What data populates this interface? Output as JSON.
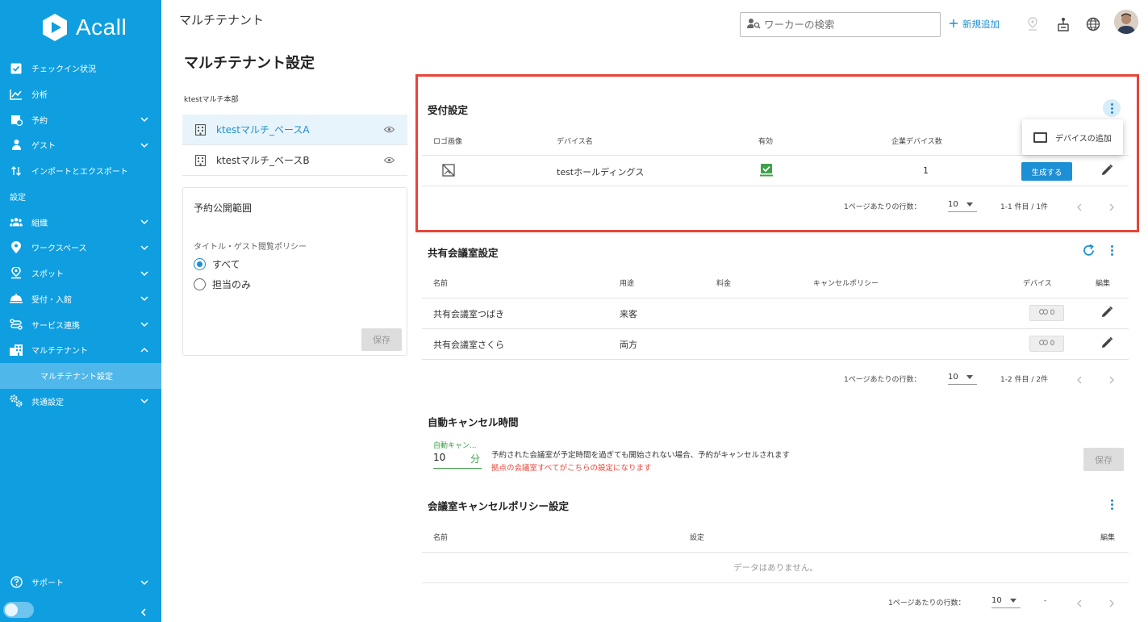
{
  "app": {
    "logo_text": "Acall",
    "page_header": "マルチテナント",
    "search_placeholder": "ワーカーの検索",
    "add_new_label": "新規追加"
  },
  "sidebar": {
    "items": [
      {
        "label": "チェックイン状況",
        "icon": "checkbox-icon"
      },
      {
        "label": "分析",
        "icon": "chart-icon"
      },
      {
        "label": "予約",
        "icon": "calendar-icon",
        "expandable": true
      },
      {
        "label": "ゲスト",
        "icon": "guest-icon",
        "expandable": true
      },
      {
        "label": "インポートとエクスポート",
        "icon": "import-export-icon"
      }
    ],
    "section_label": "設定",
    "settings_items": [
      {
        "label": "組織",
        "icon": "people-icon",
        "expandable": true
      },
      {
        "label": "ワークスペース",
        "icon": "location-icon",
        "expandable": true
      },
      {
        "label": "スポット",
        "icon": "spot-icon",
        "expandable": true
      },
      {
        "label": "受付・入館",
        "icon": "reception-icon",
        "expandable": true
      },
      {
        "label": "サービス連携",
        "icon": "integration-icon",
        "expandable": true
      },
      {
        "label": "マルチテナント",
        "icon": "building-icon",
        "expanded": true
      }
    ],
    "sub_item": "マルチテナント設定",
    "common_settings": "共通設定",
    "support": "サポート"
  },
  "left": {
    "title": "マルチテナント設定",
    "org_label": "ktestマルチ本部",
    "tenants": [
      {
        "name": "ktestマルチ_ベースA",
        "active": true
      },
      {
        "name": "ktestマルチ_ベースB",
        "active": false
      }
    ],
    "card_title": "予約公開範囲",
    "policy_label": "タイトル・ゲスト閲覧ポリシー",
    "options": [
      "すべて",
      "担当のみ"
    ],
    "selected_option": "すべて",
    "save_label": "保存"
  },
  "reception": {
    "title": "受付設定",
    "headers": [
      "ロゴ画像",
      "デバイス名",
      "有効",
      "企業デバイス数"
    ],
    "row": {
      "device_name": "testホールディングス",
      "enabled": true,
      "company_devices": "1",
      "generate_label": "生成する"
    },
    "menu_item": "デバイスの追加",
    "pagination": {
      "rows_label": "1ページあたりの行数：",
      "rows_value": "10",
      "range": "1-1 件目 / 1件"
    }
  },
  "shared_rooms": {
    "title": "共有会議室設定",
    "headers": [
      "名前",
      "用途",
      "料金",
      "キャンセルポリシー",
      "デバイス",
      "編集"
    ],
    "rows": [
      {
        "name": "共有会議室つばき",
        "usage": "来客",
        "devices": "0"
      },
      {
        "name": "共有会議室さくら",
        "usage": "両方",
        "devices": "0"
      }
    ],
    "pagination": {
      "rows_label": "1ページあたりの行数：",
      "rows_value": "10",
      "range": "1-2 件目 / 2件"
    }
  },
  "auto_cancel": {
    "title": "自動キャンセル時間",
    "field_label": "自動キャン...",
    "value": "10",
    "unit": "分",
    "description": "予約された会議室が予定時間を過ぎても開始されない場合、予約がキャンセルされます",
    "note": "拠点の会議室すべてがこちらの設定になります",
    "save_label": "保存"
  },
  "cancel_policy": {
    "title": "会議室キャンセルポリシー設定",
    "headers": [
      "名前",
      "設定",
      "編集"
    ],
    "empty_text": "データはありません。",
    "pagination": {
      "rows_label": "1ページあたりの行数：",
      "rows_value": "10",
      "range": "-"
    }
  },
  "colors": {
    "sidebar": "#0f9fe0",
    "accent": "#1d8fd4",
    "highlight": "#e84438",
    "success": "#3fa14a"
  }
}
